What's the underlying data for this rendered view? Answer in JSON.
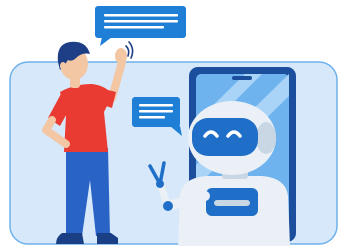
{
  "colors": {
    "background": "#ffffff",
    "panel_fill": "#d6e8fa",
    "panel_stroke": "#6fb1ea",
    "bubble": "#1f7fd6",
    "bubble_lines": "#ffffff",
    "phone_frame": "#1b4f9e",
    "phone_screen": "#6fb3ee",
    "screen_stripes": "#a9d4f7",
    "robot_body": "#eaf0f6",
    "robot_shadow": "#c9d6e3",
    "robot_visor": "#1f6fc9",
    "robot_eyes": "#ffffff",
    "skin": "#f3c7a4",
    "hair": "#1e3f86",
    "shirt": "#ea3b32",
    "pants": "#2a63c6",
    "shoes": "#1b3f85"
  },
  "scene": {
    "icons": [
      "speech-bubble-top-icon",
      "speech-bubble-left-icon",
      "wave-lines-icon"
    ],
    "characters": [
      "man-waving",
      "robot-in-phone"
    ]
  }
}
